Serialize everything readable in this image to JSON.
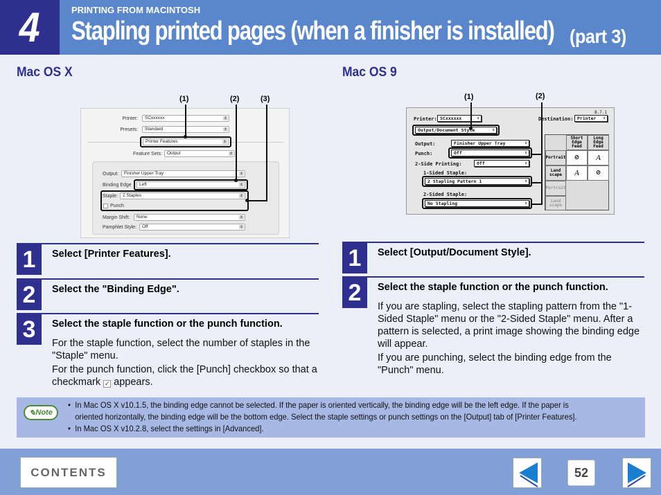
{
  "header": {
    "chapter_number": "4",
    "section": "PRINTING FROM MACINTOSH",
    "title": "Stapling printed pages (when a finisher is installed)",
    "part": "(part 3)"
  },
  "left": {
    "heading": "Mac OS X",
    "screenshot": {
      "callouts": [
        "(1)",
        "(2)",
        "(3)"
      ],
      "printer_label": "Printer:",
      "printer_value": "SCxxxxxx",
      "presets_label": "Presets:",
      "presets_value": "Standard",
      "panel_value": "Printer Features",
      "feature_sets_label": "Feature Sets:",
      "feature_sets_value": "Output",
      "output_label": "Output:",
      "output_value": "Finisher Upper Tray",
      "binding_label": "Binding Edge",
      "binding_value": "Left",
      "staple_label": "Staple:",
      "staple_value": "2 Staples",
      "punch_label": "Punch",
      "margin_label": "Margin Shift:",
      "margin_value": "None",
      "pamphlet_label": "Pamphlet Style:",
      "pamphlet_value": "Off"
    },
    "steps": [
      {
        "num": "1",
        "title": "Select [Printer Features].",
        "body": []
      },
      {
        "num": "2",
        "title": "Select the \"Binding Edge\".",
        "body": []
      },
      {
        "num": "3",
        "title": "Select the staple function or the punch function.",
        "body": [
          "For the staple function, select the number of staples in the \"Staple\" menu.",
          "For the punch function, click the [Punch] checkbox so that a checkmark",
          "appears."
        ]
      }
    ]
  },
  "right": {
    "heading": "Mac OS 9",
    "screenshot": {
      "callouts": [
        "(1)",
        "(2)"
      ],
      "version": "8.7.1",
      "printer_label": "Printer:",
      "printer_value": "SCxxxxxx",
      "destination_label": "Destination:",
      "destination_value": "Printer",
      "panel_value": "Output/Document Style",
      "output_label": "Output:",
      "output_value": "Finisher Upper Tray",
      "punch_label": "Punch:",
      "punch_value": "Off",
      "two_side_label": "2-Side Printing:",
      "two_side_value": "Off",
      "one_sided_label": "1-Sided Staple:",
      "one_sided_value": "2 Stapling Pattern 1",
      "two_sided_label": "2-Sided Staple:",
      "two_sided_value": "No Stapling",
      "table_headers": [
        "Short Edge Feed",
        "Long Edge Feed"
      ],
      "row_labels": [
        "Portrait",
        "Land scape",
        "Portrait",
        "Land scape"
      ]
    },
    "steps": [
      {
        "num": "1",
        "title": "Select [Output/Document Style].",
        "body": []
      },
      {
        "num": "2",
        "title": "Select the staple function or the punch function.",
        "body": [
          "If you are stapling, select the stapling pattern from the \"1-Sided Staple\" menu or the \"2-Sided Staple\" menu. After a pattern is selected, a print image showing the binding edge will appear.",
          "If you are punching, select the binding edge from the \"Punch\" menu."
        ]
      }
    ]
  },
  "note": {
    "badge": "Note",
    "items": [
      "In Mac OS X v10.1.5, the binding edge cannot be selected. If the paper is oriented vertically, the binding edge will be the left edge. If the paper is",
      "oriented horizontally, the binding edge will be the bottom edge. Select the staple settings or punch settings on the [Output] tab of [Printer Features].",
      "In Mac OS X v10.2.8, select the settings in [Advanced]."
    ]
  },
  "footer": {
    "contents_label": "CONTENTS",
    "page_number": "52",
    "prev_icon": "left-arrow",
    "next_icon": "right-arrow"
  },
  "colors": {
    "header_bg": "#5a87cc",
    "chapter_bg": "#2e2f8f",
    "heading_text": "#2e3091",
    "note_bg": "#a7b8e4",
    "footer_bg": "#81a0d8",
    "arrow_blue": "#1a7fd0"
  }
}
